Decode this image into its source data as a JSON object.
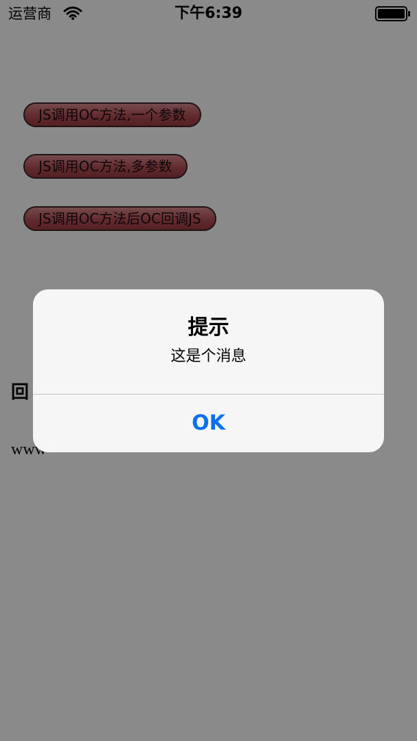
{
  "status_bar": {
    "carrier": "运营商",
    "time": "下午6:39"
  },
  "buttons": [
    {
      "label": "JS调用OC方法,一个参数"
    },
    {
      "label": "JS调用OC方法,多参数"
    },
    {
      "label": "JS调用OC方法后OC回调JS"
    }
  ],
  "page": {
    "callback_label": "回",
    "www_text": "www"
  },
  "alert": {
    "title": "提示",
    "message": "这是个消息",
    "ok_label": "OK"
  },
  "colors": {
    "accent": "#0a6ff0",
    "button_fill": "#b65157"
  }
}
